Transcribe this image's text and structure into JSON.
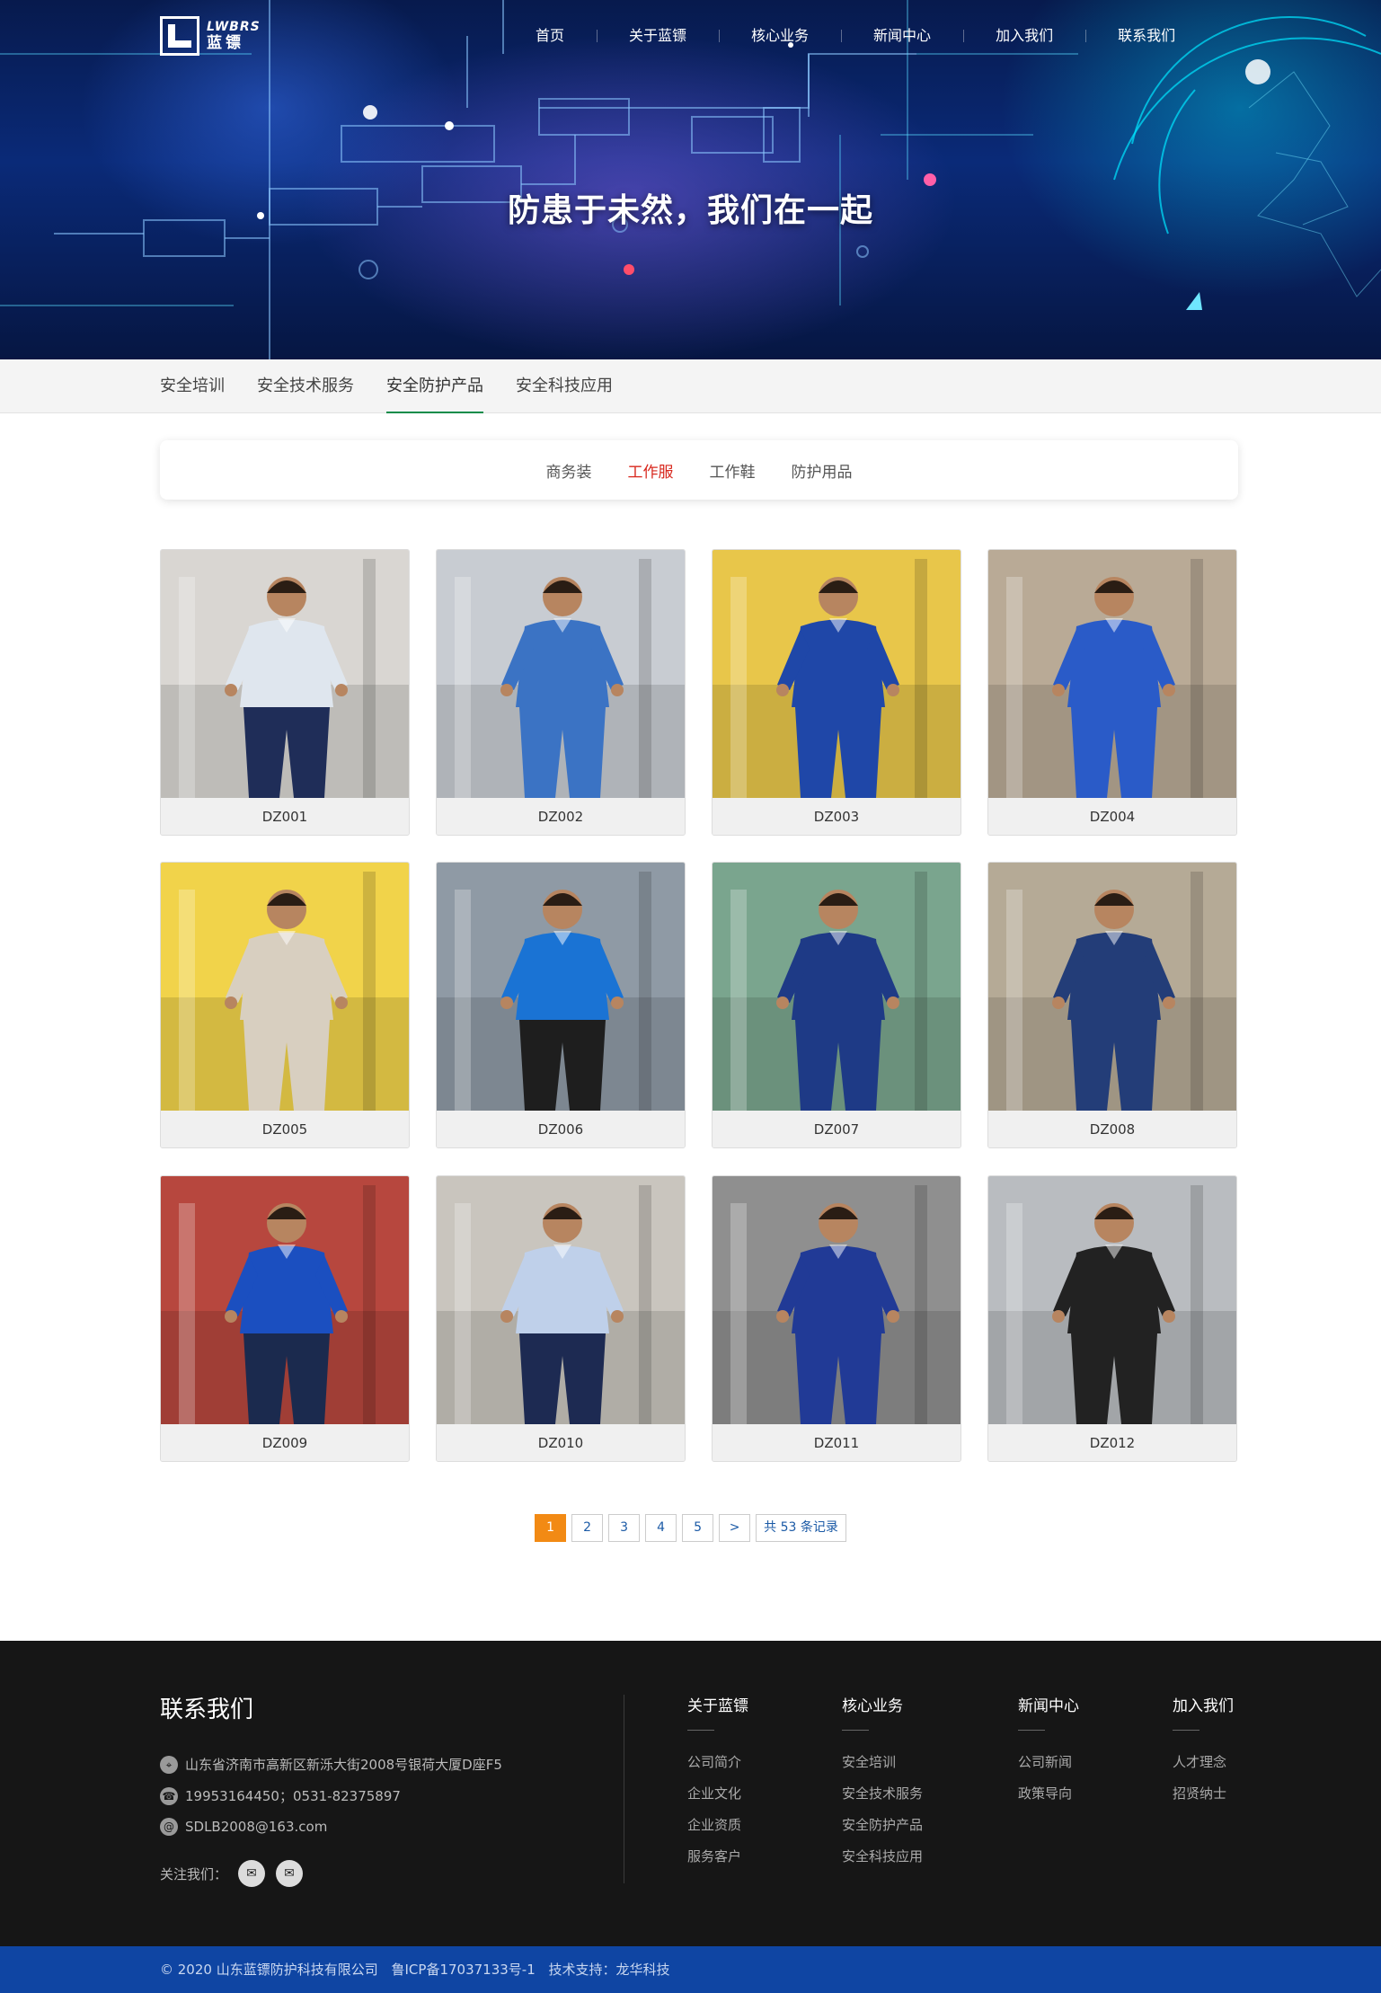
{
  "logo": {
    "en": "LWBRS",
    "cn": "蓝镖"
  },
  "nav": [
    "首页",
    "关于蓝镖",
    "核心业务",
    "新闻中心",
    "加入我们",
    "联系我们"
  ],
  "banner": {
    "slogan": "防患于未然，我们在一起"
  },
  "subnav": [
    "安全培训",
    "安全技术服务",
    "安全防护产品",
    "安全科技应用"
  ],
  "subnav_active": 2,
  "filters": [
    "商务装",
    "工作服",
    "工作鞋",
    "防护用品"
  ],
  "filter_active": 1,
  "products": [
    {
      "code": "DZ001",
      "shirt": "#dfe6ee",
      "pants": "#1f2d58",
      "bg": "#d9d6d2"
    },
    {
      "code": "DZ002",
      "shirt": "#3b73c4",
      "pants": "#3b73c4",
      "bg": "#c8ccd2"
    },
    {
      "code": "DZ003",
      "shirt": "#1f47a8",
      "pants": "#1f47a8",
      "bg": "#e8c64a"
    },
    {
      "code": "DZ004",
      "shirt": "#2a5bc8",
      "pants": "#2a5bc8",
      "bg": "#b9aa96"
    },
    {
      "code": "DZ005",
      "shirt": "#d8cfc0",
      "pants": "#d8cfc0",
      "bg": "#f1d34a"
    },
    {
      "code": "DZ006",
      "shirt": "#1a73d4",
      "pants": "#1e1e1e",
      "bg": "#8f9aa5"
    },
    {
      "code": "DZ007",
      "shirt": "#1e3a86",
      "pants": "#1e3a86",
      "bg": "#7aa58e"
    },
    {
      "code": "DZ008",
      "shirt": "#233d78",
      "pants": "#233d78",
      "bg": "#b5aa96"
    },
    {
      "code": "DZ009",
      "shirt": "#1b4fc0",
      "pants": "#1b2a4e",
      "bg": "#b7473e"
    },
    {
      "code": "DZ010",
      "shirt": "#bfd0ea",
      "pants": "#1d2a52",
      "bg": "#c9c5be"
    },
    {
      "code": "DZ011",
      "shirt": "#213a96",
      "pants": "#213a96",
      "bg": "#8f8f8f"
    },
    {
      "code": "DZ012",
      "shirt": "#222222",
      "pants": "#222222",
      "bg": "#b9bcc0"
    }
  ],
  "pagination": {
    "pages": [
      "1",
      "2",
      "3",
      "4",
      "5"
    ],
    "active": 0,
    "next": ">",
    "total": "共 53 条记录"
  },
  "footer": {
    "title": "联系我们",
    "address": "山东省济南市高新区新泺大街2008号银荷大厦D座F5",
    "phone": "19953164450；0531-82375897",
    "email": "SDLB2008@163.com",
    "follow": "关注我们：",
    "columns": [
      {
        "title": "关于蓝镖",
        "links": [
          "公司简介",
          "企业文化",
          "企业资质",
          "服务客户"
        ]
      },
      {
        "title": "核心业务",
        "links": [
          "安全培训",
          "安全技术服务",
          "安全防护产品",
          "安全科技应用"
        ]
      },
      {
        "title": "新闻中心",
        "links": [
          "公司新闻",
          "政策导向"
        ]
      },
      {
        "title": "加入我们",
        "links": [
          "人才理念",
          "招贤纳士"
        ]
      }
    ]
  },
  "copyright": {
    "owner": "© 2020 山东蓝镖防护科技有限公司",
    "icp": "鲁ICP备17037133号-1",
    "support": "技术支持：龙华科技"
  },
  "colors": {
    "accent_green": "#0b8c4a",
    "accent_red": "#d8281e",
    "pager_orange": "#f28a14",
    "footer_bg": "#161616",
    "copyright_bg": "#0f45a3"
  }
}
